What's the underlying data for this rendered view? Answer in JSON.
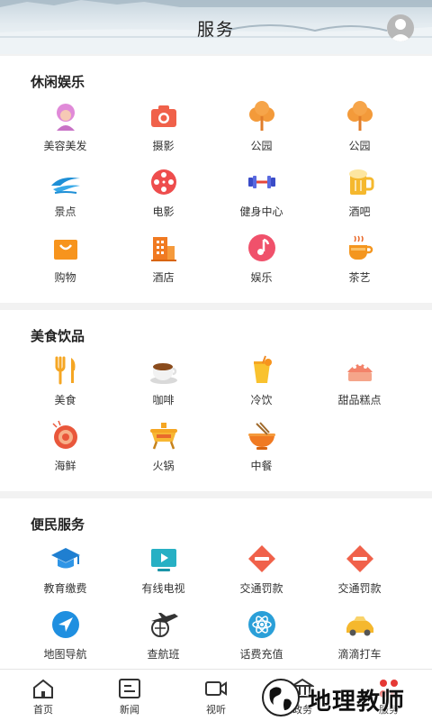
{
  "header": {
    "title": "服务"
  },
  "sections": [
    {
      "title": "休闲娱乐",
      "items": [
        {
          "label": "美容美发",
          "icon": "beauty-icon"
        },
        {
          "label": "摄影",
          "icon": "camera-icon"
        },
        {
          "label": "公园",
          "icon": "tree-icon"
        },
        {
          "label": "公园",
          "icon": "tree-icon"
        },
        {
          "label": "景点",
          "icon": "scenic-wave-icon"
        },
        {
          "label": "电影",
          "icon": "film-reel-icon"
        },
        {
          "label": "健身中心",
          "icon": "dumbbell-icon"
        },
        {
          "label": "酒吧",
          "icon": "beer-icon"
        },
        {
          "label": "购物",
          "icon": "shopping-bag-icon"
        },
        {
          "label": "酒店",
          "icon": "hotel-icon"
        },
        {
          "label": "娱乐",
          "icon": "music-note-icon"
        },
        {
          "label": "茶艺",
          "icon": "tea-cup-icon"
        }
      ]
    },
    {
      "title": "美食饮品",
      "items": [
        {
          "label": "美食",
          "icon": "fork-knife-icon"
        },
        {
          "label": "咖啡",
          "icon": "coffee-icon"
        },
        {
          "label": "冷饮",
          "icon": "cold-drink-icon"
        },
        {
          "label": "甜品糕点",
          "icon": "cake-icon"
        },
        {
          "label": "海鲜",
          "icon": "shrimp-icon"
        },
        {
          "label": "火锅",
          "icon": "hotpot-icon"
        },
        {
          "label": "中餐",
          "icon": "noodle-bowl-icon"
        }
      ]
    },
    {
      "title": "便民服务",
      "items": [
        {
          "label": "教育缴费",
          "icon": "graduation-cap-icon"
        },
        {
          "label": "有线电视",
          "icon": "tv-icon"
        },
        {
          "label": "交通罚款",
          "icon": "no-entry-icon"
        },
        {
          "label": "交通罚款",
          "icon": "no-entry-icon"
        },
        {
          "label": "地图导航",
          "icon": "navigation-icon"
        },
        {
          "label": "查航班",
          "icon": "airplane-icon"
        },
        {
          "label": "话费充值",
          "icon": "atom-icon"
        },
        {
          "label": "滴滴打车",
          "icon": "car-icon"
        }
      ]
    }
  ],
  "tabbar": [
    {
      "label": "首页",
      "icon": "home-icon"
    },
    {
      "label": "新闻",
      "icon": "news-icon"
    },
    {
      "label": "视听",
      "icon": "video-icon"
    },
    {
      "label": "政务",
      "icon": "government-icon"
    },
    {
      "label": "服务",
      "icon": "service-icon"
    }
  ],
  "watermark": {
    "text": "地理教师"
  }
}
